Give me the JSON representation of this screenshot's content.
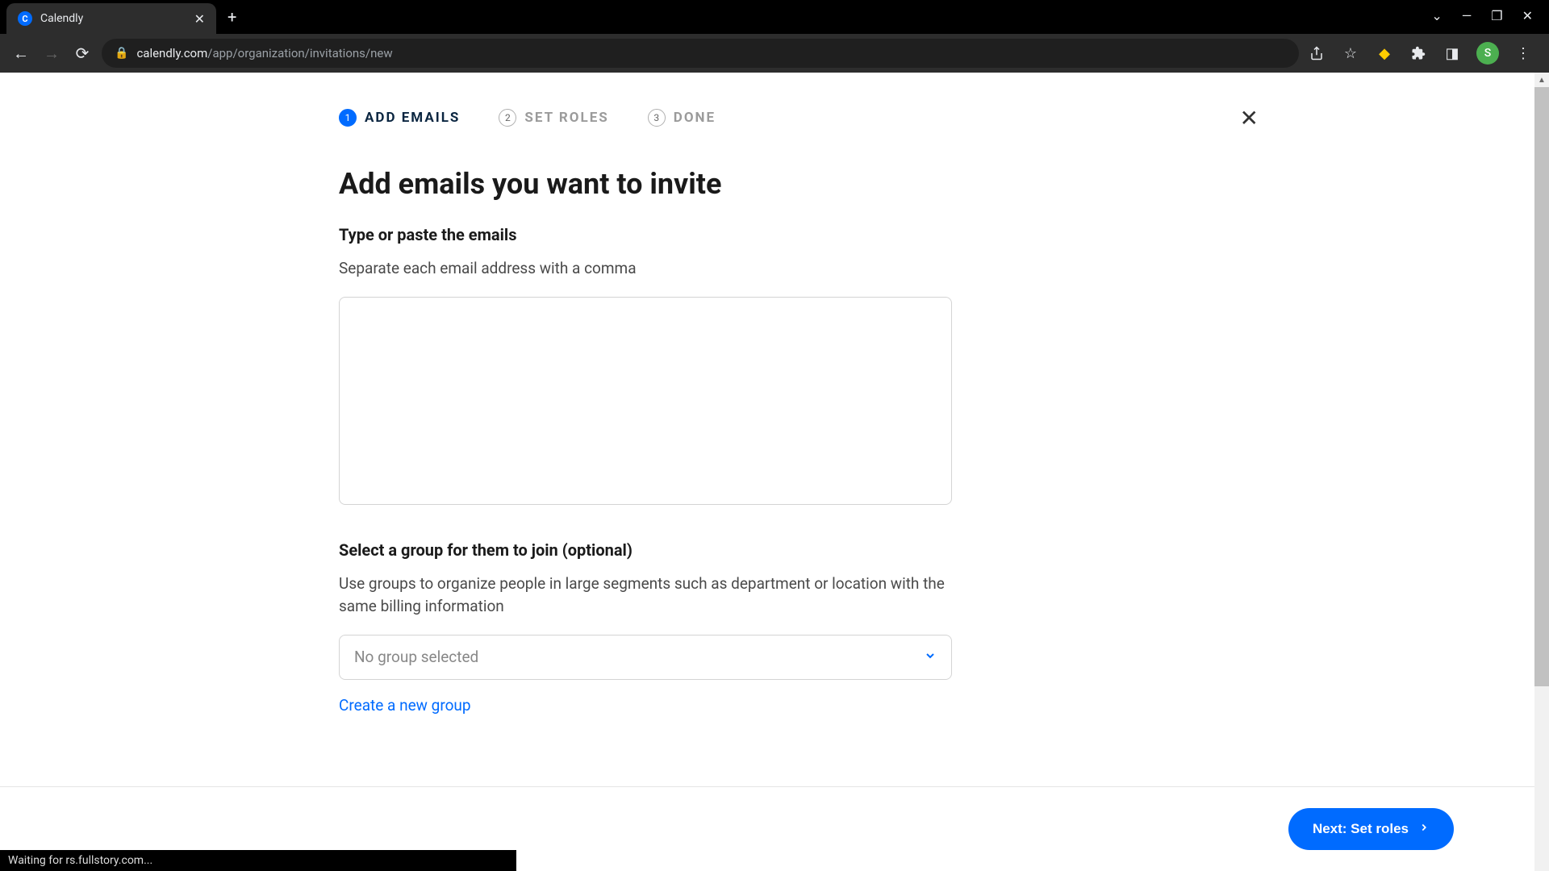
{
  "browser": {
    "tab_title": "Calendly",
    "url_domain": "calendly.com",
    "url_path": "/app/organization/invitations/new",
    "profile_initial": "S"
  },
  "stepper": {
    "steps": [
      {
        "number": "1",
        "label": "ADD EMAILS",
        "active": true
      },
      {
        "number": "2",
        "label": "SET ROLES",
        "active": false
      },
      {
        "number": "3",
        "label": "DONE",
        "active": false
      }
    ]
  },
  "page_heading": "Add emails you want to invite",
  "email_field": {
    "label": "Type or paste the emails",
    "hint": "Separate each email address with a comma",
    "value": ""
  },
  "group_field": {
    "label": "Select a group for them to join (optional)",
    "hint": "Use groups to organize people in large segments such as department or location with the same billing information",
    "placeholder": "No group selected"
  },
  "create_group_link": "Create a new group",
  "next_button": "Next: Set roles",
  "status_text": "Waiting for rs.fullstory.com..."
}
